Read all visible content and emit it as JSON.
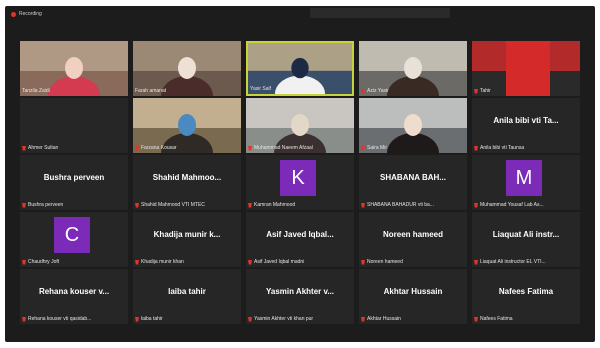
{
  "recording": {
    "label": "Recording"
  },
  "grid": {
    "tiles": [
      {
        "caption": "Tanzila Zaidi",
        "muted": false,
        "type": "video"
      },
      {
        "caption": "Farah amanat",
        "muted": false,
        "type": "video"
      },
      {
        "caption": "Yasir Saif",
        "muted": false,
        "type": "video",
        "active": true
      },
      {
        "caption": "Aziz Yasir",
        "muted": true,
        "type": "video"
      },
      {
        "caption": "Tahir",
        "muted": true,
        "type": "video"
      },
      {
        "caption": "Ahmer Sultan",
        "muted": true,
        "type": "blank"
      },
      {
        "caption": "Farzana Kousar",
        "muted": true,
        "type": "video"
      },
      {
        "caption": "Muhammad Naeem Afzaal",
        "muted": true,
        "type": "video"
      },
      {
        "caption": "Saira Mir",
        "muted": true,
        "type": "video"
      },
      {
        "caption": "Anila bibi vti Taunsa",
        "muted": true,
        "type": "name",
        "display": "Anila bibi vti Ta..."
      },
      {
        "caption": "Bushra perveen",
        "muted": true,
        "type": "name",
        "display": "Bushra perveen"
      },
      {
        "caption": "Shahid Mahmood VTI MTEC",
        "muted": true,
        "type": "name",
        "display": "Shahid Mahmoo..."
      },
      {
        "caption": "Kamran Mahmood",
        "muted": true,
        "type": "avatar",
        "initial": "K"
      },
      {
        "caption": "SHABANA BAHADUR vti ba...",
        "muted": true,
        "type": "name",
        "display": "SHABANA BAH..."
      },
      {
        "caption": "Muhammad Yousaf Lab As...",
        "muted": true,
        "type": "avatar",
        "initial": "M"
      },
      {
        "caption": "Chaudhry Joft",
        "muted": true,
        "type": "avatar",
        "initial": "C"
      },
      {
        "caption": "Khadija munir khan",
        "muted": true,
        "type": "name",
        "display": "Khadija munir k..."
      },
      {
        "caption": "Asif Javed Iqbal madni",
        "muted": true,
        "type": "name",
        "display": "Asif Javed Iqbal..."
      },
      {
        "caption": "Noreen hameed",
        "muted": true,
        "type": "name",
        "display": "Noreen hameed"
      },
      {
        "caption": "Liaquat Ali instructor EL VTI...",
        "muted": true,
        "type": "name",
        "display": "Liaquat Ali instr..."
      },
      {
        "caption": "Rehana kouser vti qasidab...",
        "muted": true,
        "type": "name",
        "display": "Rehana kouser v..."
      },
      {
        "caption": "laiba tahir",
        "muted": true,
        "type": "name",
        "display": "laiba tahir"
      },
      {
        "caption": "Yasmin Akhter vti khan pur",
        "muted": true,
        "type": "name",
        "display": "Yasmin Akhter v..."
      },
      {
        "caption": "Akhtar Hussain",
        "muted": true,
        "type": "name",
        "display": "Akhtar Hussain"
      },
      {
        "caption": "Nafees Fatima",
        "muted": true,
        "type": "name",
        "display": "Nafees Fatima"
      }
    ]
  },
  "colors": {
    "avatar": "#7b2bb8",
    "active_border": "#c7d33b",
    "mic_muted": "#e0352b"
  }
}
